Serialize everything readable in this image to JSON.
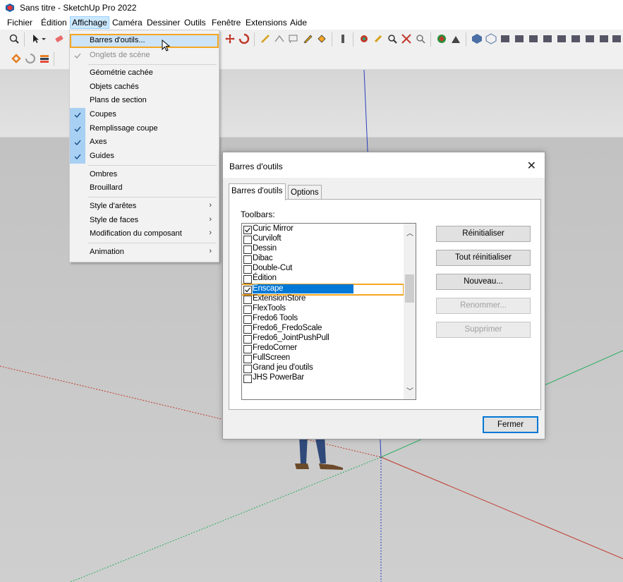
{
  "window": {
    "title": "Sans titre - SketchUp Pro 2022"
  },
  "menubar": {
    "items": [
      "Fichier",
      "Édition",
      "Affichage",
      "Caméra",
      "Dessiner",
      "Outils",
      "Fenêtre",
      "Extensions",
      "Aide"
    ],
    "active": "Affichage"
  },
  "view_menu": {
    "items": [
      {
        "label": "Barres d'outils...",
        "checked": false,
        "submenu": false,
        "disabled": false,
        "highlighted": true
      },
      {
        "label": "Onglets de scène",
        "checked": true,
        "submenu": false,
        "disabled": true
      },
      {
        "label": "Géométrie cachée",
        "checked": false,
        "submenu": false
      },
      {
        "label": "Objets cachés",
        "checked": false,
        "submenu": false
      },
      {
        "label": "Plans de section",
        "checked": false,
        "submenu": false
      },
      {
        "label": "Coupes",
        "checked": true,
        "submenu": false
      },
      {
        "label": "Remplissage coupe",
        "checked": true,
        "submenu": false
      },
      {
        "label": "Axes",
        "checked": true,
        "submenu": false
      },
      {
        "label": "Guides",
        "checked": true,
        "submenu": false
      },
      {
        "label": "Ombres",
        "checked": false,
        "submenu": false
      },
      {
        "label": "Brouillard",
        "checked": false,
        "submenu": false
      },
      {
        "label": "Style d'arêtes",
        "checked": false,
        "submenu": true
      },
      {
        "label": "Style de faces",
        "checked": false,
        "submenu": true
      },
      {
        "label": "Modification du composant",
        "checked": false,
        "submenu": true
      },
      {
        "label": "Animation",
        "checked": false,
        "submenu": true
      }
    ]
  },
  "dialog": {
    "title": "Barres d'outils",
    "close_glyph": "✕",
    "tabs": [
      "Barres d'outils",
      "Options"
    ],
    "list_label": "Toolbars:",
    "toolbars": [
      {
        "name": "Curic Mirror",
        "checked": true
      },
      {
        "name": "Curviloft",
        "checked": false
      },
      {
        "name": "Dessin",
        "checked": false
      },
      {
        "name": "Dibac",
        "checked": false
      },
      {
        "name": "Double-Cut",
        "checked": false
      },
      {
        "name": "Édition",
        "checked": false
      },
      {
        "name": "Enscape",
        "checked": true,
        "selected": true
      },
      {
        "name": "ExtensionStore",
        "checked": false
      },
      {
        "name": "FlexTools",
        "checked": false
      },
      {
        "name": "Fredo6 Tools",
        "checked": false
      },
      {
        "name": "Fredo6_FredoScale",
        "checked": false
      },
      {
        "name": "Fredo6_JointPushPull",
        "checked": false
      },
      {
        "name": "FredoCorner",
        "checked": false
      },
      {
        "name": "FullScreen",
        "checked": false
      },
      {
        "name": "Grand jeu d'outils",
        "checked": false
      },
      {
        "name": "JHS PowerBar",
        "checked": false
      }
    ],
    "buttons": {
      "reset": "Réinitialiser",
      "reset_all": "Tout réinitialiser",
      "new": "Nouveau...",
      "rename": "Renommer...",
      "delete": "Supprimer",
      "close": "Fermer"
    }
  },
  "colors": {
    "accent_frame": "#f5a623",
    "selection": "#0078d7",
    "menu_check": "#a8d0f3"
  }
}
